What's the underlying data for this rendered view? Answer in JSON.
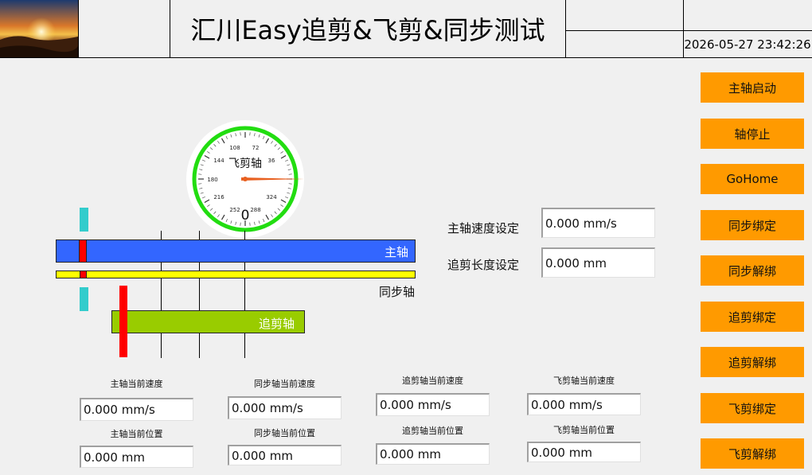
{
  "header": {
    "title": "汇川Easy追剪&飞剪&同步测试",
    "datetime": "2026-05-27 23:42:26"
  },
  "side_buttons": [
    {
      "label": "主轴启动"
    },
    {
      "label": "轴停止"
    },
    {
      "label": "GoHome"
    },
    {
      "label": "同步绑定"
    },
    {
      "label": "同步解绑"
    },
    {
      "label": "追剪绑定"
    },
    {
      "label": "追剪解绑"
    },
    {
      "label": "飞剪绑定"
    },
    {
      "label": "飞剪解绑"
    }
  ],
  "settings": {
    "master_speed_label": "主轴速度设定",
    "master_speed_value": "0.000 mm/s",
    "chase_length_label": "追剪长度设定",
    "chase_length_value": "0.000 mm"
  },
  "animation": {
    "master_label": "主轴",
    "sync_label": "同步轴",
    "chase_label": "追剪轴"
  },
  "gauge": {
    "label": "飞剪轴",
    "value": "0",
    "ticks": [
      "108",
      "72",
      "144",
      "36",
      "180",
      "216",
      "324",
      "252",
      "288"
    ],
    "needle_deg": 0,
    "colors": {
      "ring": "#22dd11",
      "needle": "#e86020"
    }
  },
  "readouts": {
    "master": {
      "speed_label": "主轴当前速度",
      "speed": "0.000 mm/s",
      "pos_label": "主轴当前位置",
      "pos": "0.000 mm"
    },
    "sync": {
      "speed_label": "同步轴当前速度",
      "speed": "0.000 mm/s",
      "pos_label": "同步轴当前位置",
      "pos": "0.000 mm"
    },
    "chase": {
      "speed_label": "追剪轴当前速度",
      "speed": "0.000 mm/s",
      "pos_label": "追剪轴当前位置",
      "pos": "0.000 mm"
    },
    "flying": {
      "speed_label": "飞剪轴当前速度",
      "speed": "0.000 mm/s",
      "pos_label": "飞剪轴当前位置",
      "pos": "0.000 mm"
    }
  },
  "colors": {
    "button": "#ff9a00",
    "master_bar": "#3366ff",
    "sync_bar": "#ffff00",
    "chase_bar": "#99cc00",
    "marker": "#ff0000",
    "cyan_marker": "#33cccc"
  }
}
